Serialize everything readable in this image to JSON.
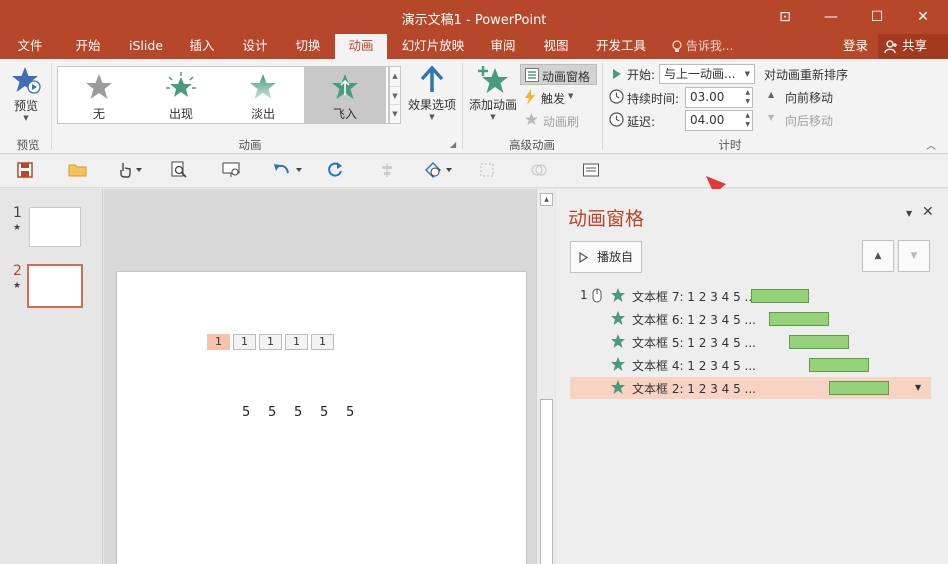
{
  "window": {
    "title": "演示文稿1 - PowerPoint",
    "buttons": {
      "ribbon_display": "⊡",
      "minimize": "—",
      "maximize": "☐",
      "close": "✕"
    }
  },
  "tabs": [
    {
      "label": "文件"
    },
    {
      "label": "开始"
    },
    {
      "label": "iSlide"
    },
    {
      "label": "插入"
    },
    {
      "label": "设计"
    },
    {
      "label": "切换"
    },
    {
      "label": "动画",
      "active": true
    },
    {
      "label": "幻灯片放映"
    },
    {
      "label": "审阅"
    },
    {
      "label": "视图"
    },
    {
      "label": "开发工具"
    }
  ],
  "tell_me": "告诉我...",
  "login": "登录",
  "share": "共享",
  "ribbon": {
    "preview": {
      "button": "预览",
      "group": "预览"
    },
    "animation": {
      "group": "动画",
      "gallery": [
        "无",
        "出现",
        "淡出",
        "飞入"
      ],
      "selected": "飞入",
      "effect_options": "效果选项"
    },
    "advanced": {
      "group": "高级动画",
      "add_animation": "添加动画",
      "animation_pane": "动画窗格",
      "trigger": "触发",
      "animation_painter": "动画刷"
    },
    "timing": {
      "group": "计时",
      "start_label": "开始:",
      "start_value": "与上一动画...",
      "duration_label": "持续时间:",
      "duration_value": "03.00",
      "delay_label": "延迟:",
      "delay_value": "04.00"
    },
    "reorder": {
      "title": "对动画重新排序",
      "move_earlier": "向前移动",
      "move_later": "向后移动"
    }
  },
  "slides": [
    {
      "number": "1"
    },
    {
      "number": "2",
      "selected": true
    }
  ],
  "slide": {
    "number_boxes": [
      "1",
      "1",
      "1",
      "1",
      "1"
    ],
    "fives": [
      "5",
      "5",
      "5",
      "5",
      "5"
    ]
  },
  "pane": {
    "title": "动画窗格",
    "play_from": "播放自",
    "items": [
      {
        "order": "1",
        "label": "文本框 7: 1 2 3 4 5 ..."
      },
      {
        "order": "",
        "label": "文本框 6: 1 2 3 4 5 ..."
      },
      {
        "order": "",
        "label": "文本框 5: 1 2 3 4 5 ..."
      },
      {
        "order": "",
        "label": "文本框 4: 1 2 3 4 5 ..."
      },
      {
        "order": "",
        "label": "文本框 2: 1 2 3 4 5 ...",
        "selected": true
      }
    ]
  },
  "colors": {
    "accent": "#b7472a",
    "star": "#4a9a7e",
    "bar": "#95d27a",
    "selected_row": "#f8d2c2"
  }
}
